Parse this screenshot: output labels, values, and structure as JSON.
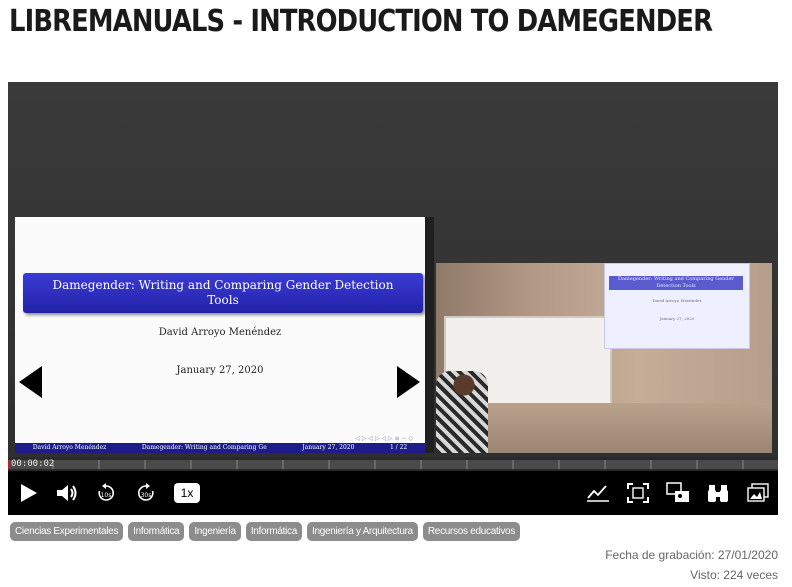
{
  "page": {
    "title": "LIBREMANUALS - INTRODUCTION TO DAMEGENDER"
  },
  "slide": {
    "title_line1": "Damegender: Writing and Comparing Gender Detection",
    "title_line2": "Tools",
    "author": "David Arroyo Menéndez",
    "date": "January 27, 2020",
    "footer_author": "David Arroyo Menéndez",
    "footer_title": "Damegender: Writing and Comparing Ge",
    "footer_date": "January 27, 2020",
    "footer_page": "1 / 22"
  },
  "camera": {
    "projected_title": "Damegender: Writing and Comparing Gender Detection Tools",
    "projected_author": "David Arroyo Menéndez",
    "projected_date": "January 27, 2020"
  },
  "player": {
    "current_time": "00:00:02",
    "progress_fraction": 0.003,
    "speed": "1x",
    "accent_color": "#c41c1c",
    "icons": [
      "play-icon",
      "volume-icon",
      "rewind-10-icon",
      "forward-30-icon",
      "stats-icon",
      "fullscreen-icon",
      "layout-switch-icon",
      "binoculars-icon",
      "gallery-icon"
    ]
  },
  "tags": [
    "Ciencias Experimentales",
    "Informática",
    "Ingeniería",
    "Informática",
    "Ingeniería y Arquitectura",
    "Recursos educativos"
  ],
  "meta": {
    "recorded": "Fecha de grabación: 27/01/2020",
    "views": "Visto: 224 veces"
  }
}
